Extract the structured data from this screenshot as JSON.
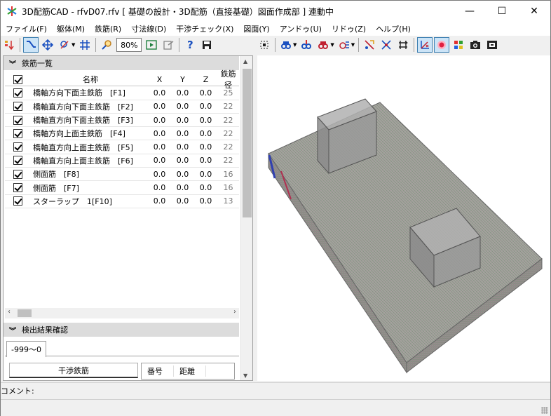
{
  "window": {
    "title": "3D配筋CAD - rfvD07.rfv [ 基礎の設計・3D配筋（直接基礎）図面作成部 ] 連動中",
    "minimize": "—",
    "maximize": "☐",
    "close": "✕"
  },
  "menu": [
    "ファイル(F)",
    "躯体(M)",
    "鉄筋(R)",
    "寸法線(D)",
    "干渉チェック(X)",
    "図面(Y)",
    "アンドゥ(U)",
    "リドゥ(Z)",
    "ヘルプ(H)"
  ],
  "toolbar": {
    "zoom": "80%"
  },
  "rebar_panel": {
    "title": "鉄筋一覧",
    "columns": {
      "name": "名称",
      "x": "X",
      "y": "Y",
      "z": "Z",
      "dia": "鉄筋径"
    },
    "rows": [
      {
        "name": "橋軸方向下面主鉄筋　[F1]",
        "x": "0.0",
        "y": "0.0",
        "z": "0.0",
        "dia": "25"
      },
      {
        "name": "橋軸直方向下面主鉄筋　[F2]",
        "x": "0.0",
        "y": "0.0",
        "z": "0.0",
        "dia": "22"
      },
      {
        "name": "橋軸直方向下面主鉄筋　[F3]",
        "x": "0.0",
        "y": "0.0",
        "z": "0.0",
        "dia": "22"
      },
      {
        "name": "橋軸方向上面主鉄筋　[F4]",
        "x": "0.0",
        "y": "0.0",
        "z": "0.0",
        "dia": "22"
      },
      {
        "name": "橋軸直方向上面主鉄筋　[F5]",
        "x": "0.0",
        "y": "0.0",
        "z": "0.0",
        "dia": "22"
      },
      {
        "name": "橋軸直方向上面主鉄筋　[F6]",
        "x": "0.0",
        "y": "0.0",
        "z": "0.0",
        "dia": "22"
      },
      {
        "name": "側面筋　[F8]",
        "x": "0.0",
        "y": "0.0",
        "z": "0.0",
        "dia": "16"
      },
      {
        "name": "側面筋　[F7]",
        "x": "0.0",
        "y": "0.0",
        "z": "0.0",
        "dia": "16"
      },
      {
        "name": "スターラップ　1[F10]",
        "x": "0.0",
        "y": "0.0",
        "z": "0.0",
        "dia": "13"
      }
    ]
  },
  "check_panel": {
    "title": "検出結果確認",
    "tab": "-999〜0",
    "button": "干渉鉄筋",
    "col_no": "番号",
    "col_dist": "距離"
  },
  "comment": {
    "label": "コメント:"
  },
  "colors": {
    "concrete": "#9a9e96",
    "block": "#8c8c8c",
    "rebar_red": "#b03050",
    "rebar_blue": "#3040b0",
    "active_border": "#3c7fb1"
  }
}
